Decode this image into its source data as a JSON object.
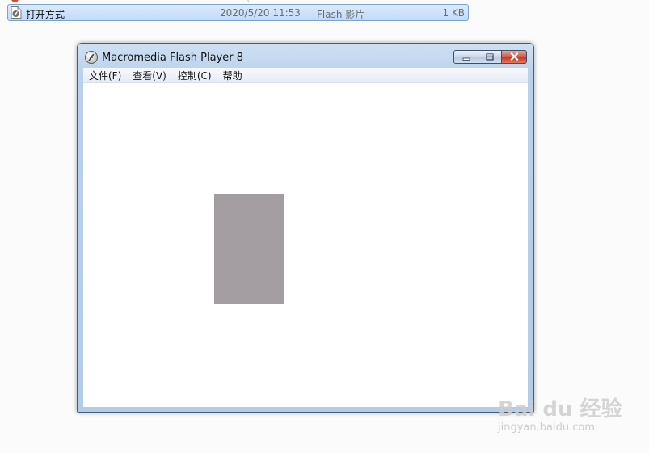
{
  "explorer": {
    "top_partial_text": "(",
    "file": {
      "icon": "flash-file-icon",
      "name": "打开方式",
      "date": "2020/5/20 11:53",
      "type": "Flash 影片",
      "size": "1 KB"
    }
  },
  "window": {
    "title": "Macromedia Flash Player 8",
    "icon": "flash-player-icon",
    "menu": [
      "文件(F)",
      "查看(V)",
      "控制(C)",
      "帮助"
    ],
    "stage": {
      "shape_color": "#a39ca1",
      "background": "#ffffff"
    }
  },
  "watermark": {
    "brand": "Bai du 经验",
    "url": "jingyan.baidu.com"
  },
  "colors": {
    "selection_fill": "#c1dbfc",
    "selection_border": "#7da2ce",
    "window_frame": "#b9d1ec",
    "close_button": "#c4331f"
  }
}
